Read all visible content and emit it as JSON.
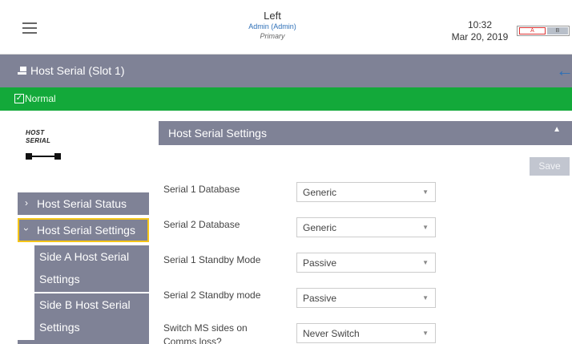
{
  "header": {
    "title": "Left",
    "user": "Admin (Admin)",
    "role": "Primary",
    "time": "10:32",
    "date": "Mar 20, 2019",
    "side_a_label": "A",
    "side_b_label": "B"
  },
  "titlebar": {
    "title": "Host Serial (Slot 1)"
  },
  "status": {
    "text": "Normal",
    "check": "✓",
    "color": "#13a93a"
  },
  "logo": {
    "line1": "HOST",
    "line2": "SERIAL"
  },
  "nav": {
    "status_item": {
      "chevron": "›",
      "label": "Host Serial Status"
    },
    "settings_item": {
      "chevron": "›",
      "label": "Host Serial Settings"
    },
    "sub_items": [
      {
        "line1": "Side A Host Serial",
        "line2": "Settings"
      },
      {
        "line1": "Side B Host Serial",
        "line2": "Settings"
      }
    ]
  },
  "panel": {
    "title": "Host Serial Settings",
    "save_label": "Save",
    "fields": [
      {
        "label": "Serial 1 Database",
        "value": "Generic"
      },
      {
        "label": "Serial 2 Database",
        "value": "Generic"
      },
      {
        "label": "Serial 1 Standby Mode",
        "value": "Passive"
      },
      {
        "label": "Serial 2 Standby mode",
        "value": "Passive"
      },
      {
        "label_line1": "Switch MS sides on",
        "label_line2": "Comms loss?",
        "value": "Never Switch"
      }
    ]
  },
  "icons": {
    "menu": "hamburger-icon",
    "back": "back-arrow-icon",
    "collapse": "chevron-up-icon",
    "dropdown": "caret-down-icon"
  },
  "colors": {
    "header_gray": "#7f8296",
    "status_green": "#13a93a",
    "highlight_yellow": "#f5c518",
    "accent_blue": "#2d6fb7"
  }
}
